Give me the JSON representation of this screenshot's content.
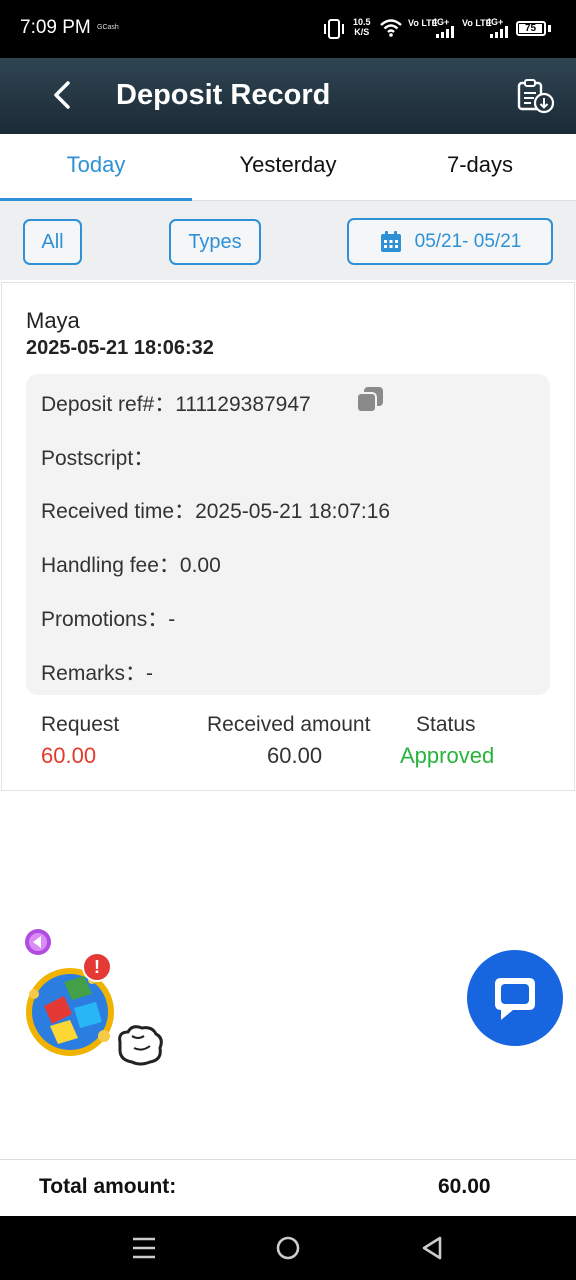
{
  "status_bar": {
    "time": "7:09 PM",
    "carrier_note": "GCash",
    "speed_value": "10.5",
    "speed_unit": "K/S",
    "net1": "4G+",
    "net1_sub": "Vo LTE",
    "net2": "4G+",
    "net2_sub": "Vo LTE",
    "battery": "75",
    "icons": [
      "vibrate-icon",
      "wifi-icon",
      "signal-icon",
      "battery-icon"
    ]
  },
  "header": {
    "back_icon": "chevron-left-icon",
    "title": "Deposit Record",
    "export_icon": "clipboard-download-icon"
  },
  "tabs": [
    {
      "label": "Today",
      "active": true
    },
    {
      "label": "Yesterday",
      "active": false
    },
    {
      "label": "7-days",
      "active": false
    }
  ],
  "filters": {
    "all_label": "All",
    "types_label": "Types",
    "date_range": "05/21- 05/21",
    "calendar_icon": "calendar-icon"
  },
  "record": {
    "method": "Maya",
    "datetime": "2025-05-21 18:06:32",
    "details": {
      "ref_label": "Deposit ref#：",
      "ref_value": "111129387947",
      "postscript_label": "Postscript：",
      "postscript_value": "",
      "received_time_label": "Received time：",
      "received_time_value": "2025-05-21 18:07:16",
      "handling_fee_label": "Handling fee：",
      "handling_fee_value": "0.00",
      "promotions_label": "Promotions：",
      "promotions_value": "-",
      "remarks_label": "Remarks：",
      "remarks_value": "-"
    },
    "summary": {
      "request_label": "Request",
      "request_value": "60.00",
      "received_label": "Received amount",
      "received_value": "60.00",
      "status_label": "Status",
      "status_value": "Approved"
    }
  },
  "floating": {
    "collapse_icon": "purple-arrow-left-icon",
    "promo_icon": "promo-cubes-icon",
    "alert_badge": "!",
    "chat_icon": "chat-bubble-icon"
  },
  "footer": {
    "total_label": "Total amount:",
    "total_value": "60.00"
  },
  "nav_bar": {
    "icons": [
      "menu-icon",
      "home-icon",
      "back-icon"
    ]
  },
  "colors": {
    "accent": "#2e91d6",
    "header_bg": "#24343f",
    "request_red": "#e23a2b",
    "approved_green": "#27b33c",
    "chat_blue": "#1766e0"
  }
}
